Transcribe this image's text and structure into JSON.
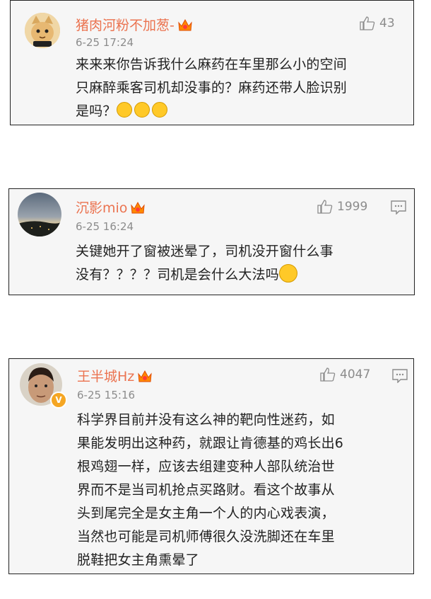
{
  "comments": [
    {
      "username": "猪肉河粉不加葱-",
      "time": "6-25 17:24",
      "likes": "43",
      "lines": [
        "来来来你告诉我什么麻药在车里那么小的空间",
        "只麻醉乘客司机却没事的？麻药还带人脸识别",
        "是吗？"
      ],
      "trailing_emoji": [
        "dizzy-emoji",
        "dizzy-emoji",
        "dizzy-emoji"
      ]
    },
    {
      "username": "沉影mio",
      "time": "6-25 16:24",
      "likes": "1999",
      "lines": [
        "关键她开了窗被迷晕了，司机没开窗什么事",
        "没有？？？？司机是会什么大法吗"
      ],
      "trailing_emoji": [
        "facepalm-emoji"
      ]
    },
    {
      "username": "王半城Hz",
      "time": "6-25 15:16",
      "likes": "4047",
      "lines": [
        "科学界目前并没有这么神的靶向性迷药，如",
        "果能发明出这种药，就跟让肯德基的鸡长出6",
        "根鸡翅一样，应该去组建变种人部队统治世",
        "界而不是当司机抢点买路财。看这个故事从",
        "头到尾完全是女主角一个人的内心戏表演，",
        "当然也可能是司机师傅很久没洗脚还在车里",
        "脱鞋把女主角熏晕了"
      ],
      "verified_badge": "V"
    }
  ],
  "colors": {
    "username": "#eb7350",
    "meta": "#8c8c8c",
    "text": "#222222",
    "border": "#222222",
    "card_bg": "#f6f6f6"
  },
  "icons": [
    "thumbs-up-icon",
    "reply-icon",
    "crown-icon"
  ]
}
